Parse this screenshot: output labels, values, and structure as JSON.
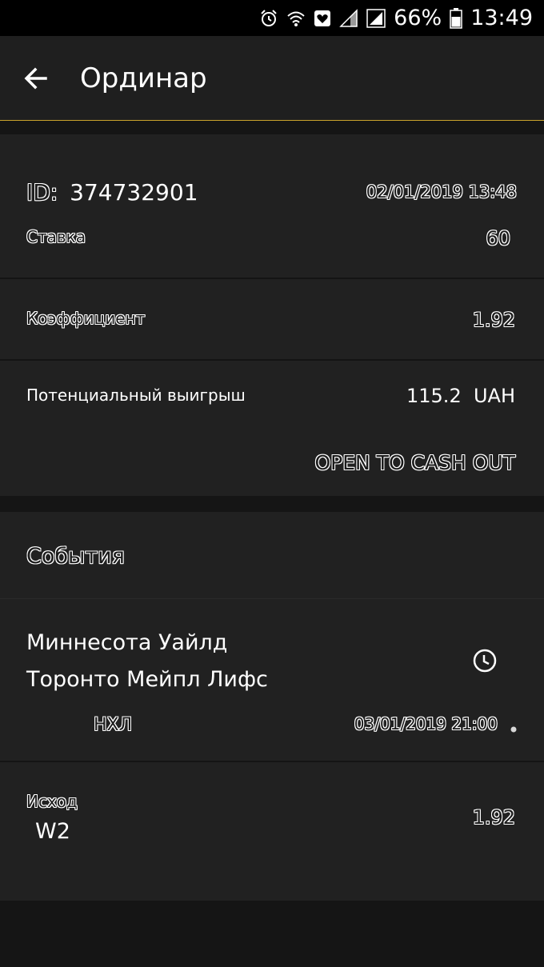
{
  "status_bar": {
    "icons": [
      "alarm-icon",
      "wifi-icon",
      "heart-notification-icon",
      "signal-icon",
      "signal-icon",
      "battery-icon"
    ],
    "battery_percent": "66%",
    "time": "13:49"
  },
  "app_bar": {
    "back_icon": "arrow-left-icon",
    "title": "Ординар"
  },
  "bet": {
    "id_label": "ID:",
    "id_value": "374732901",
    "datetime": "02/01/2019 13:48",
    "stake_label": "Ставка",
    "stake_value": "60",
    "odds_label": "Коэффициент",
    "odds_value": "1.92",
    "potential_label": "Потенциальный выигрыш",
    "potential_value": "115.2  UAH",
    "cashout_label": "OPEN TO CASH OUT"
  },
  "events": {
    "header": "События",
    "items": [
      {
        "team1": "Миннесота Уайлд",
        "team2": "Торонто Мейпл Лифс",
        "status_icon": "clock-icon",
        "league": "НХЛ",
        "datetime": "03/01/2019 21:00",
        "outcome_label": "Исход",
        "outcome_value": "W2",
        "outcome_odds": "1.92"
      }
    ]
  },
  "colors": {
    "accent": "#c9a22c",
    "card_bg": "#212121",
    "page_bg": "#151515",
    "status_bg": "#000000"
  }
}
